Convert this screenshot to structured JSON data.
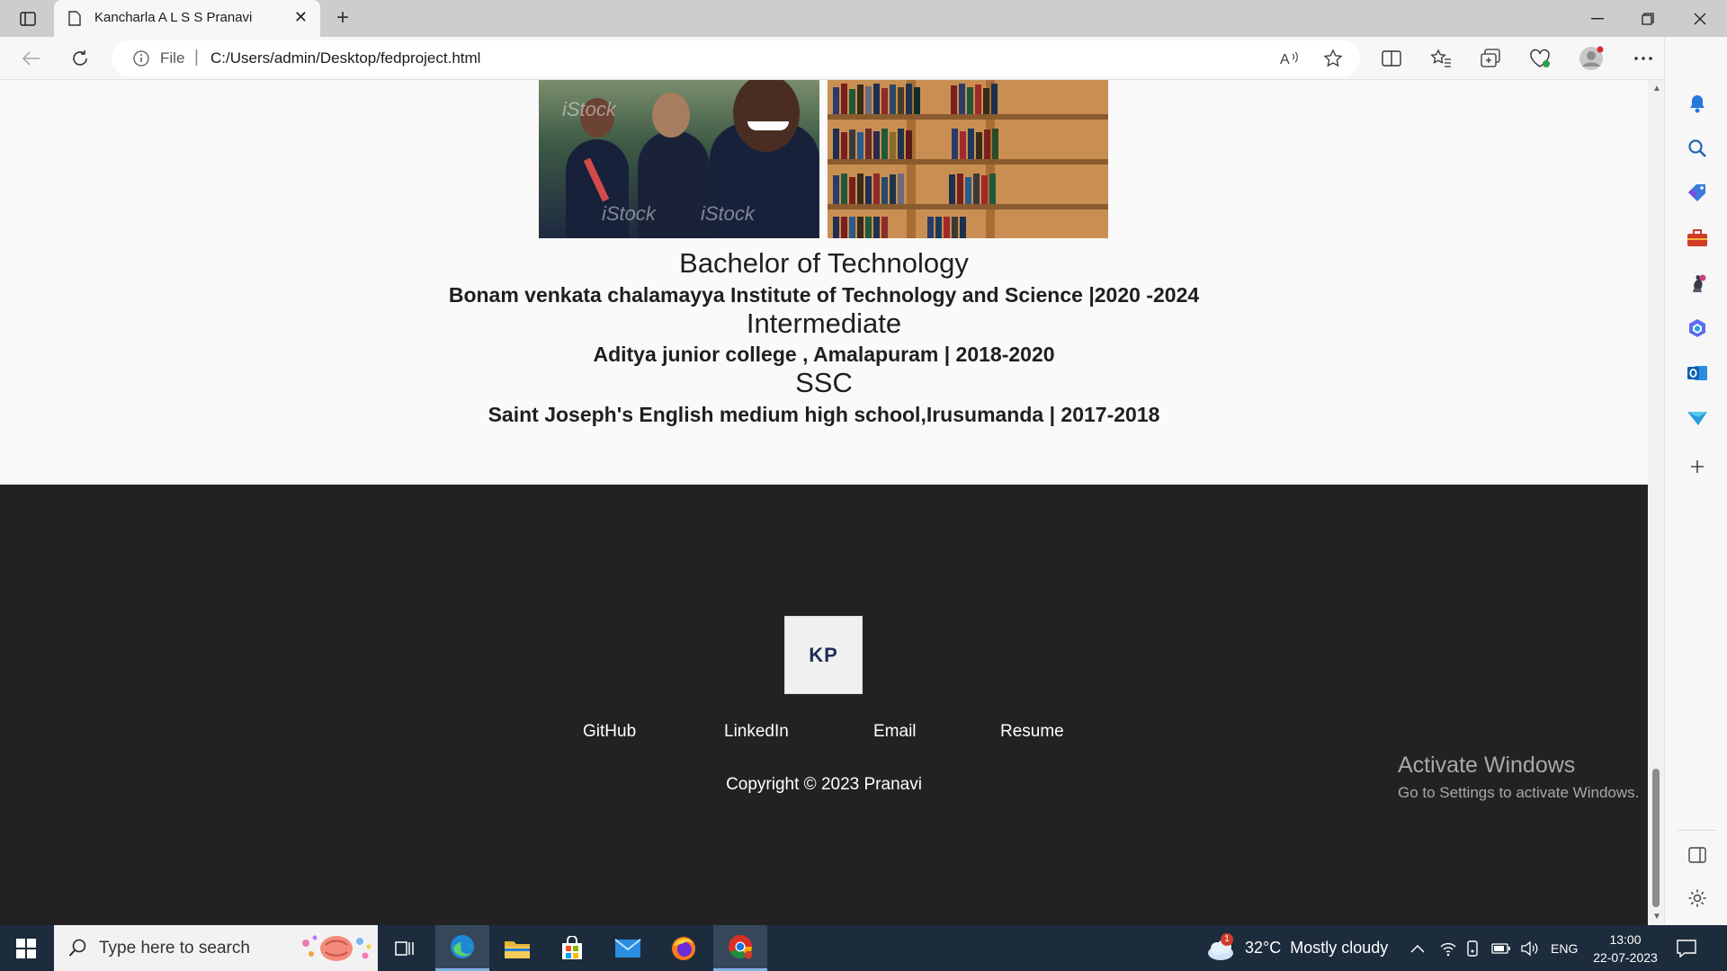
{
  "browser": {
    "tab_title": "Kancharla A L S S Pranavi",
    "address_scheme": "File",
    "address_url": "C:/Users/admin/Desktop/fedproject.html"
  },
  "education": [
    {
      "degree": "Bachelor of Technology",
      "detail": "Bonam venkata chalamayya Institute of Technology and Science |2020 -2024"
    },
    {
      "degree": "Intermediate",
      "detail": "Aditya junior college , Amalapuram | 2018-2020"
    },
    {
      "degree": "SSC",
      "detail": "Saint Joseph's English medium high school,Irusumanda | 2017-2018"
    }
  ],
  "images": {
    "graduation_watermark": "iStock"
  },
  "footer": {
    "logo_text": "KP",
    "links": [
      "GitHub",
      "LinkedIn",
      "Email",
      "Resume"
    ],
    "copyright": "Copyright © 2023 Pranavi"
  },
  "watermark": {
    "title": "Activate Windows",
    "subtitle": "Go to Settings to activate Windows."
  },
  "taskbar": {
    "search_placeholder": "Type here to search",
    "weather": "32°C  Mostly cloudy",
    "weather_badge": "1",
    "language": "ENG",
    "time": "13:00",
    "date": "22-07-2023"
  },
  "colors": {
    "footer_bg": "#222222",
    "taskbar_bg": "#1c2c3c",
    "accent": "#0f6cbd"
  }
}
